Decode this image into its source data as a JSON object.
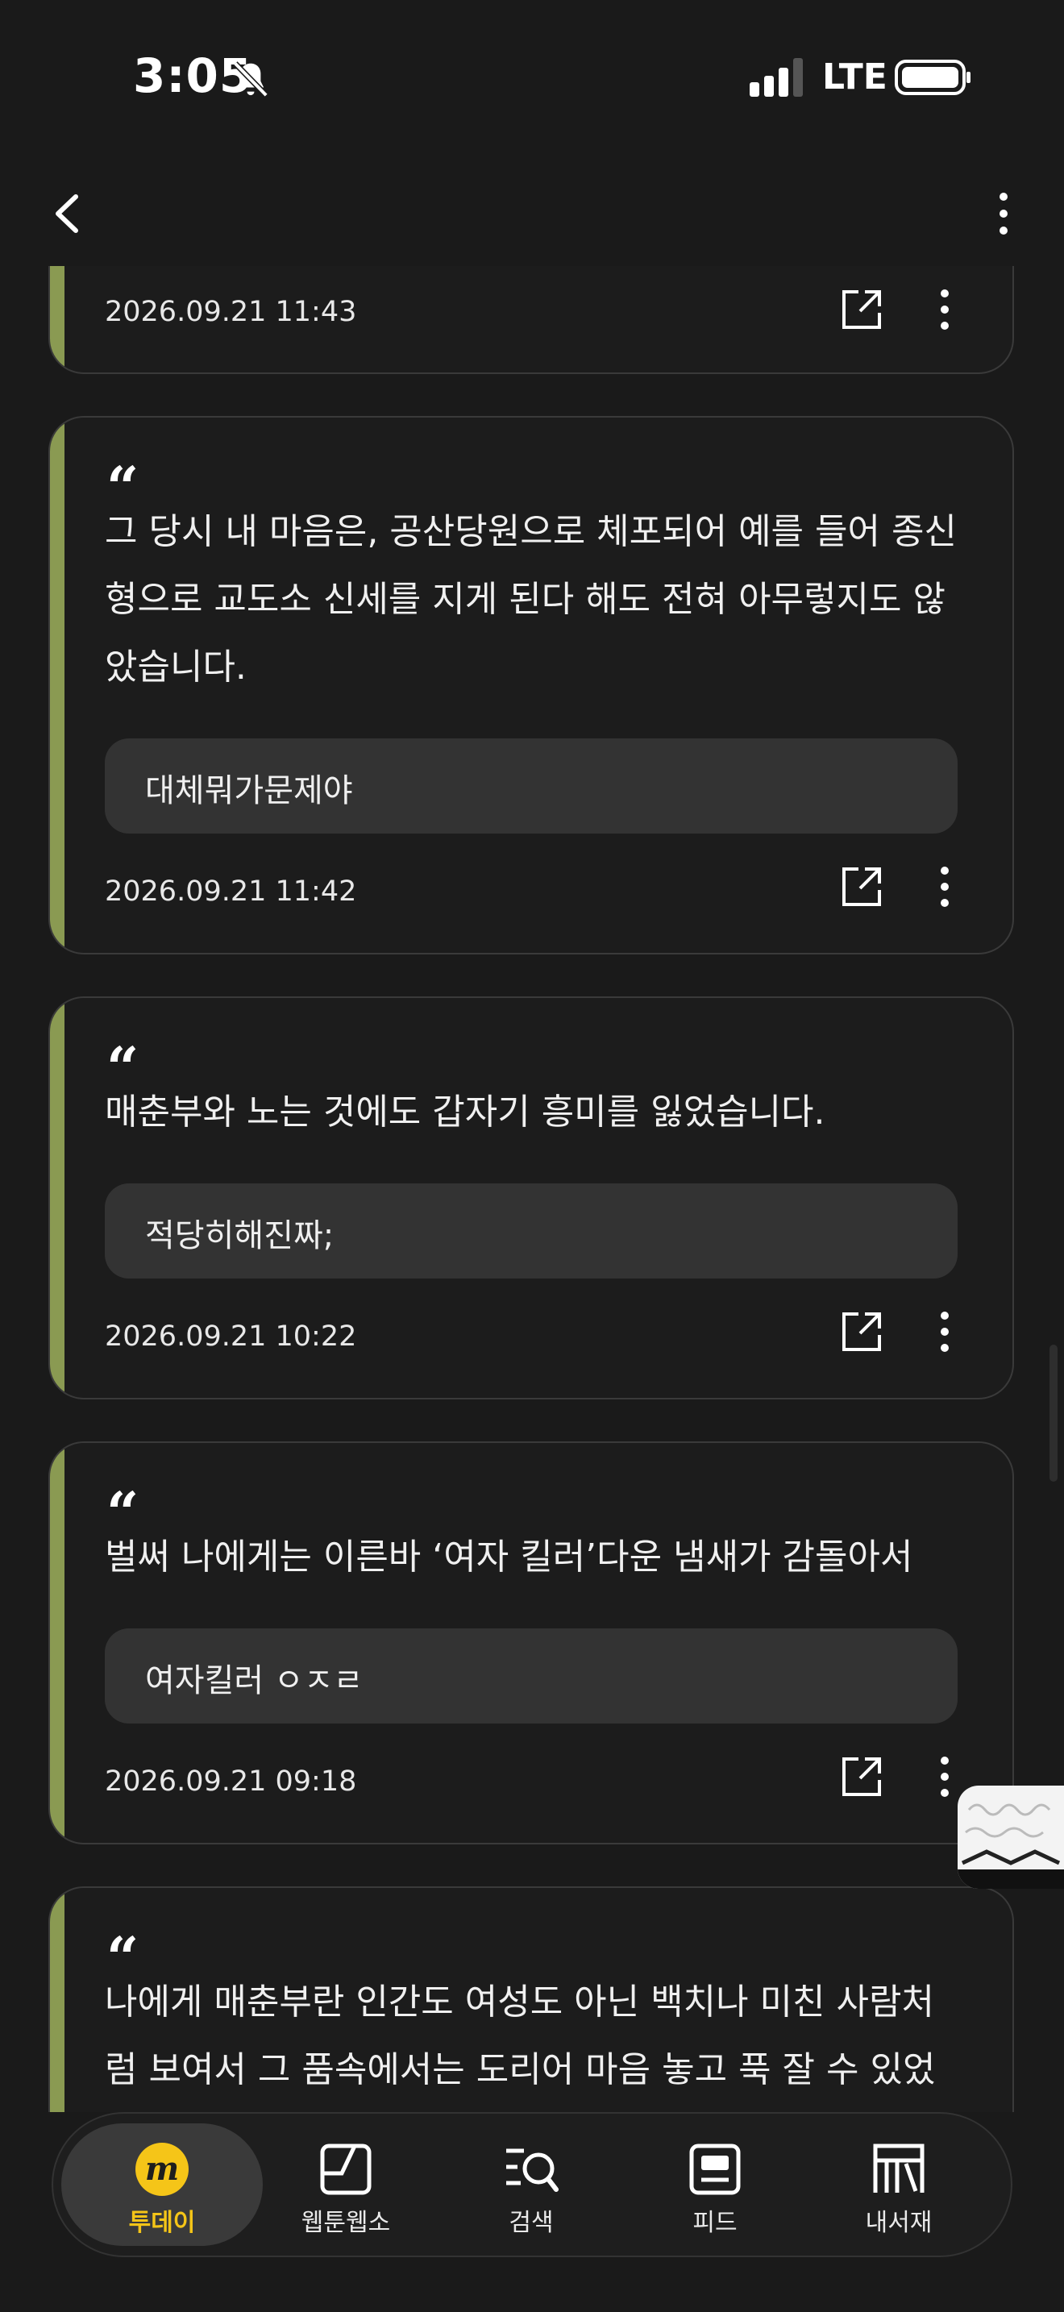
{
  "status": {
    "time": "3:05",
    "network": "LTE"
  },
  "cards": [
    {
      "date": "2026.09.21 11:43"
    },
    {
      "quote": "그 당시 내 마음은, 공산당원으로 체포되어 예를 들어 종신형으로 교도소 신세를 지게 된다 해도 전혀 아무렇지도 않았습니다.",
      "memo": "대체뭐가문제야",
      "date": "2026.09.21 11:42"
    },
    {
      "quote": "매춘부와 노는 것에도 갑자기 흥미를 잃었습니다.",
      "memo": "적당히해진짜;",
      "date": "2026.09.21 10:22"
    },
    {
      "quote": "벌써 나에게는 이른바 ‘여자 킬러’다운 냄새가 감돌아서",
      "memo": "여자킬러 ㅇㅈㄹ",
      "date": "2026.09.21 09:18"
    },
    {
      "quote": "나에게 매춘부란 인간도 여성도 아닌 백치나 미친 사람처럼 보여서 그 품속에서는 도리어 마음 놓고 푹 잘 수 있었"
    }
  ],
  "quote_mark": "“",
  "bottom_nav": [
    {
      "label": "투데이",
      "icon": "today-m-icon"
    },
    {
      "label": "웹툰웹소",
      "icon": "webtoon-icon"
    },
    {
      "label": "검색",
      "icon": "search-icon"
    },
    {
      "label": "피드",
      "icon": "feed-icon"
    },
    {
      "label": "내서재",
      "icon": "library-icon"
    }
  ],
  "colors": {
    "accent_bar": "#8a9a52",
    "active_nav": "#f5c518",
    "background": "#1a1a1a"
  }
}
